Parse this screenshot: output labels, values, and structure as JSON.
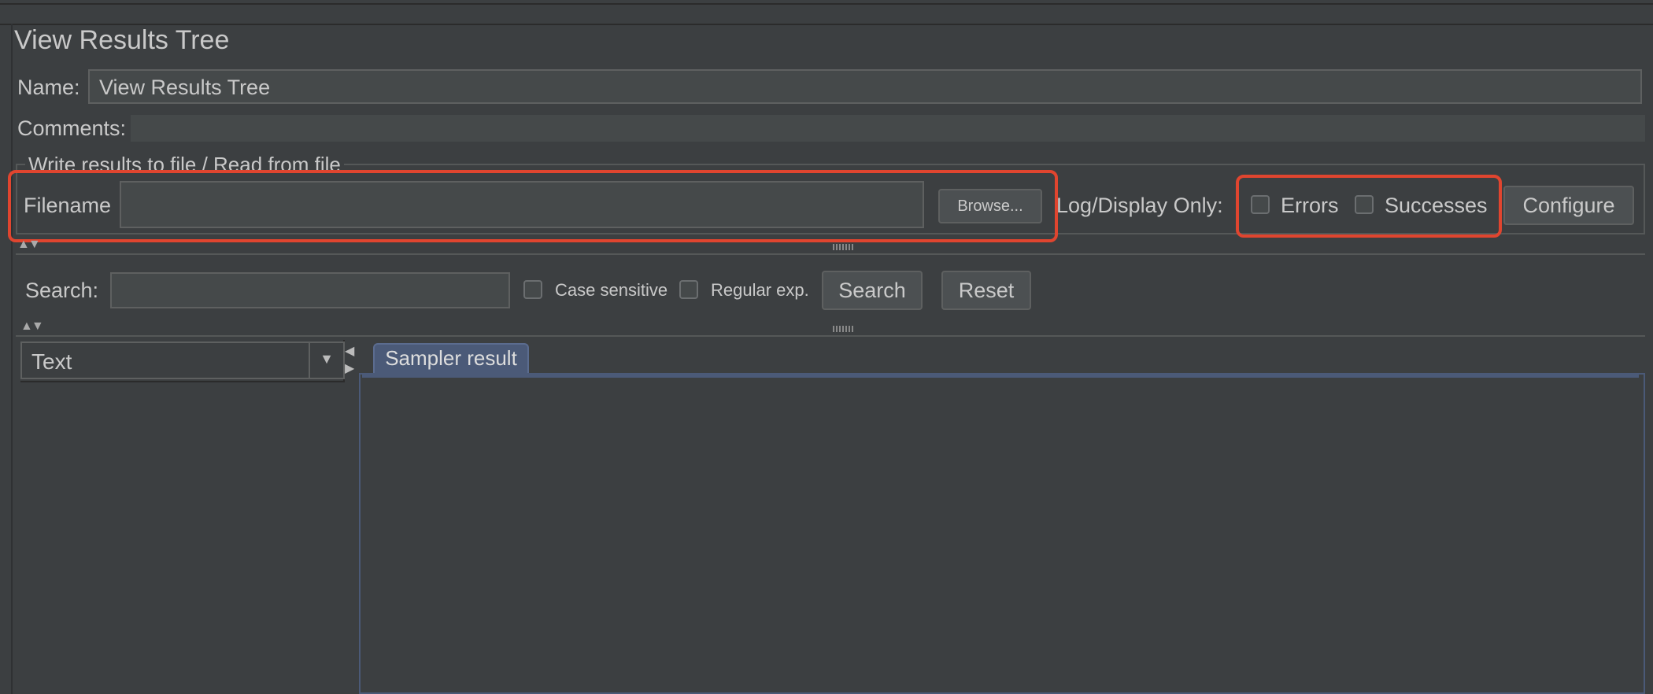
{
  "panel": {
    "title": "View Results Tree",
    "name_label": "Name:",
    "name_value": "View Results Tree",
    "comments_label": "Comments:"
  },
  "file_group": {
    "title": "Write results to file / Read from file",
    "filename_label": "Filename",
    "filename_value": "",
    "browse_label": "Browse...",
    "log_display_label": "Log/Display Only:",
    "errors_label": "Errors",
    "errors_checked": false,
    "successes_label": "Successes",
    "successes_checked": false,
    "configure_label": "Configure"
  },
  "search": {
    "label": "Search:",
    "value": "",
    "case_sensitive_label": "Case sensitive",
    "regular_exp_label": "Regular exp.",
    "search_button": "Search",
    "reset_button": "Reset"
  },
  "results": {
    "renderer_selected": "Text",
    "tabs": [
      {
        "label": "Sampler result",
        "active": true
      }
    ]
  },
  "annotations": {
    "highlight_color": "#e0452f"
  }
}
